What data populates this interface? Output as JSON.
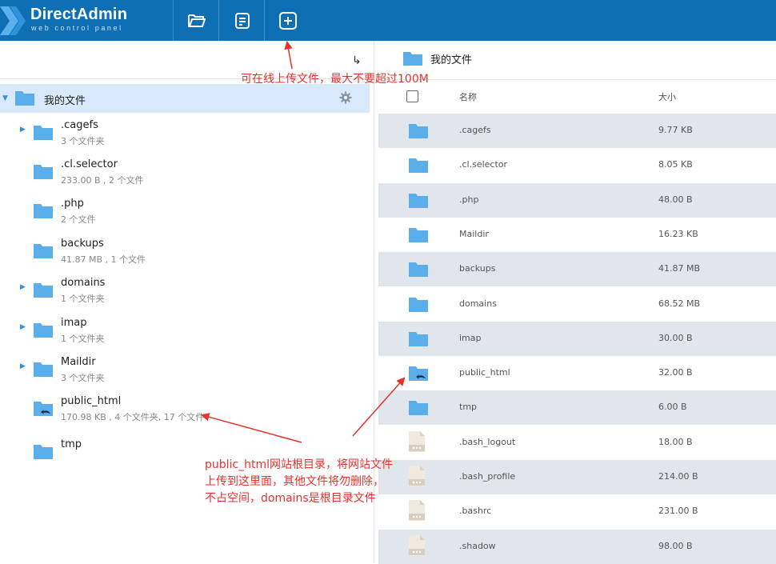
{
  "app": {
    "brand": "DirectAdmin",
    "tagline": "web control panel"
  },
  "toolbar": [
    {
      "name": "folder-open-button",
      "icon": "folder-open-icon"
    },
    {
      "name": "document-button",
      "icon": "document-icon"
    },
    {
      "name": "upload-button",
      "icon": "plus-square-icon"
    }
  ],
  "left": {
    "root_label": "我的文件",
    "items": [
      {
        "name": ".cagefs",
        "meta": "3 个文件夹",
        "expandable": true,
        "special": false
      },
      {
        "name": ".cl.selector",
        "meta": "233.00 B , 2 个文件",
        "expandable": false,
        "special": false
      },
      {
        "name": ".php",
        "meta": "2 个文件",
        "expandable": false,
        "special": false
      },
      {
        "name": "backups",
        "meta": "41.87 MB , 1 个文件",
        "expandable": false,
        "special": false
      },
      {
        "name": "domains",
        "meta": "1 个文件夹",
        "expandable": true,
        "special": false
      },
      {
        "name": "imap",
        "meta": "1 个文件夹",
        "expandable": true,
        "special": false
      },
      {
        "name": "Maildir",
        "meta": "3 个文件夹",
        "expandable": true,
        "special": false
      },
      {
        "name": "public_html",
        "meta": "170.98 KB , 4 个文件夹, 17 个文件",
        "expandable": false,
        "special": true
      },
      {
        "name": "tmp",
        "meta": "",
        "expandable": false,
        "special": false
      }
    ]
  },
  "right": {
    "title": "我的文件",
    "columns": {
      "name": "名称",
      "size": "大小"
    },
    "rows": [
      {
        "name": ".cagefs",
        "size": "9.77 KB",
        "type": "folder"
      },
      {
        "name": ".cl.selector",
        "size": "8.05 KB",
        "type": "folder"
      },
      {
        "name": ".php",
        "size": "48.00 B",
        "type": "folder"
      },
      {
        "name": "Maildir",
        "size": "16.23 KB",
        "type": "folder"
      },
      {
        "name": "backups",
        "size": "41.87 MB",
        "type": "folder"
      },
      {
        "name": "domains",
        "size": "68.52 MB",
        "type": "folder"
      },
      {
        "name": "imap",
        "size": "30.00 B",
        "type": "folder"
      },
      {
        "name": "public_html",
        "size": "32.00 B",
        "type": "folder-link"
      },
      {
        "name": "tmp",
        "size": "6.00 B",
        "type": "folder"
      },
      {
        "name": ".bash_logout",
        "size": "18.00 B",
        "type": "file"
      },
      {
        "name": ".bash_profile",
        "size": "214.00 B",
        "type": "file"
      },
      {
        "name": ".bashrc",
        "size": "231.00 B",
        "type": "file"
      },
      {
        "name": ".shadow",
        "size": "98.00 B",
        "type": "file"
      }
    ]
  },
  "annotations": {
    "upload_note": "可在线上传文件，最大不要超过100M",
    "public_html_note": [
      "public_html网站根目录，将网站文件",
      "上传到这里面，其他文件将勿删除，",
      "不占空间，domains是根目录文件"
    ]
  },
  "colors": {
    "topbar": "#0f6fb4",
    "folder": "#5aaee9",
    "selected_row": "#d7e9fb",
    "alt_row": "#e1e5ec",
    "annotation": "#e8312a"
  }
}
